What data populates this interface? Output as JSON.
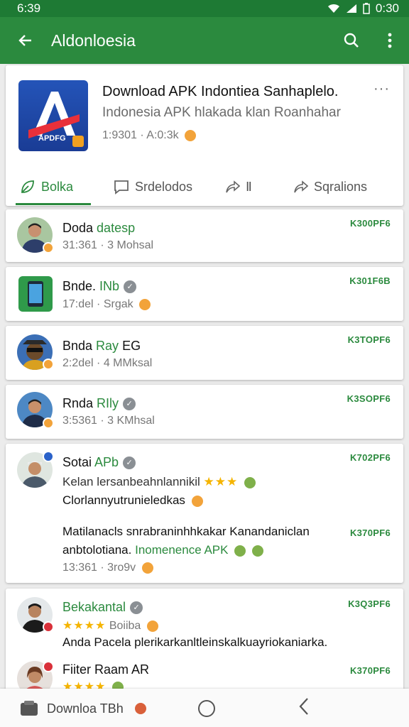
{
  "status": {
    "time": "6:39",
    "right_time": "0:30"
  },
  "appbar": {
    "title": "Aldonloesia",
    "back_icon": "arrow-left-icon",
    "search_icon": "search-icon",
    "more_icon": "more-vert-icon"
  },
  "header": {
    "title": "Download APK Indontiea Sanhaplelo.",
    "subtitle": "Indonesia APK hlakada klan Roanhahar",
    "meta": "1:9301 · A:0:3k",
    "icon_label": "APDFG",
    "more": "···",
    "tabs": [
      {
        "label": "Bolka",
        "icon": "leaf-icon"
      },
      {
        "label": "Srdelodos",
        "icon": "chat-icon"
      },
      {
        "label": "Ⅱ",
        "icon": "share-icon"
      },
      {
        "label": "Sqralions",
        "icon": "share-icon"
      }
    ]
  },
  "reviews": [
    {
      "name_a": "Doda ",
      "name_b": "datesp",
      "meta": "31:361 · 3 Mohsal",
      "price": "K300PF6"
    },
    {
      "name_a": "Bnde. ",
      "name_b": "INb",
      "meta": "17:del · Srgak",
      "price": "K301F6B",
      "verified": true
    },
    {
      "name_a": "Bnda ",
      "name_b": "Ray",
      "name_c": " EG",
      "meta": "2:2del · 4 MMksal",
      "price": "K3TOPF6"
    },
    {
      "name_a": "Rnda ",
      "name_b": "RIly",
      "meta": "3:5361 · 3 KMhsal",
      "price": "K3SOPF6",
      "verified": true
    },
    {
      "name_a": "Sotai ",
      "name_b": "APb",
      "line1": "Kelan lersanbeahnlannikil",
      "line2": "Clorlannyutrunieledkas",
      "para1": "Matilanacls snrabraninhhkakar Kanandaniclan",
      "para2a": "anbtolotiana. ",
      "para2b": "Inomenence APK",
      "meta": "13:361 · 3ro9v",
      "price": "K702PF6",
      "price2": "K370PF6",
      "verified": true
    },
    {
      "name": "Bekakantal",
      "rating_text": "Boiiba",
      "text": "Anda Pacela plerikarkanltleinskalkuayriokaniarka.",
      "price": "K3Q3PF6",
      "verified": true
    },
    {
      "name": "Fiiter Raam AR",
      "price": "K370PF6"
    }
  ],
  "stars": "★★★★",
  "stars3": "★★★",
  "navbar": {
    "label": "Downloa TBh"
  },
  "colors": {
    "primary": "#2b8a3e",
    "status": "#1e7a34",
    "star": "#f5b400"
  }
}
